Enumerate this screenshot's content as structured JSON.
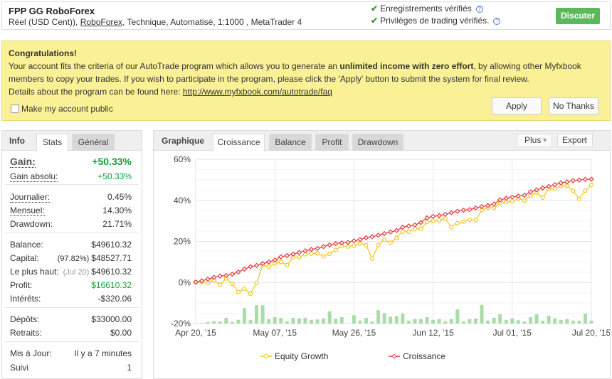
{
  "header": {
    "title": "FPP GG RoboForex",
    "subtitle_pre": "Réel (USD Cent)), ",
    "broker_link": "RoboForex",
    "subtitle_post": ", Technique, Automatisé, 1:1000 , MetaTrader 4",
    "verified": [
      "Enregistrements vérifiés",
      "Privilèges de trading vérifiés."
    ],
    "discuss_button": "Discuter"
  },
  "autotrade": {
    "title": "Congratulations!",
    "text1": "Your account fits the criteria of our AutoTrade program which allows you to generate an ",
    "text_bold": "unlimited income with zero effort",
    "text2": ", by allowing other Myfxbook members to copy your trades. If you wish to participate in the program, please click the 'Apply' button to submit the system for final review.",
    "details": "Details about the program can be found here: ",
    "link": "http://www.myfxbook.com/autotrade/faq",
    "checkbox_label": "Make my account public",
    "apply": "Apply",
    "no_thanks": "No Thanks"
  },
  "info": {
    "label": "Info",
    "tabs": [
      "Stats",
      "Général"
    ],
    "rows": [
      {
        "k": "Gain:",
        "v": "+50.33%"
      },
      {
        "k": "Gain absolu:",
        "v": "+50.33%"
      },
      {
        "k": "Journalier:",
        "v": "0.45%"
      },
      {
        "k": "Mensuel:",
        "v": "14.30%"
      },
      {
        "k": "Drawdown:",
        "v": "21.71%"
      },
      {
        "k": "Balance:",
        "v": "$49610.32"
      },
      {
        "k": "Capital:",
        "note": "(97.82%)",
        "v": "$48527.71"
      },
      {
        "k": "Le plus haut:",
        "note": "(Jul 20)",
        "v": "$49610.32"
      },
      {
        "k": "Profit:",
        "v": "$16610.32"
      },
      {
        "k": "Intérêts:",
        "v": "-$320.06"
      },
      {
        "k": "Dépôts:",
        "v": "$33000.00"
      },
      {
        "k": "Retraits:",
        "v": "$0.00"
      },
      {
        "k": "Mis à Jour:",
        "v": "Il y a 7 minutes"
      },
      {
        "k": "Suivi",
        "v": "1"
      }
    ]
  },
  "graph": {
    "label": "Graphique",
    "tabs": [
      "Croissance",
      "Balance",
      "Profit",
      "Drawdown"
    ],
    "more": "Plus",
    "export": "Export"
  },
  "chart_data": {
    "type": "line",
    "ylim": [
      -20,
      60
    ],
    "yticks": [
      "60%",
      "40%",
      "20%",
      "0%",
      "-20%"
    ],
    "ytick_values": [
      60,
      40,
      20,
      0,
      -20
    ],
    "xtick_labels": [
      "Apr 20, '15",
      "May 07, '15",
      "May 26, '15",
      "Jun 12, '15",
      "Jul 01, '15",
      "Jul 20, '15"
    ],
    "xtick_index": [
      0,
      13,
      26,
      39,
      52,
      65
    ],
    "colors": {
      "equity": "#f5c518",
      "growth": "#e8383d",
      "bars": "#a8dca8"
    },
    "series": [
      {
        "name": "Equity Growth",
        "values": [
          0.2,
          0.2,
          -0.2,
          1.0,
          -1.1,
          2.0,
          -0.6,
          -4.7,
          -3.0,
          -5.5,
          -0.2,
          8.3,
          7.7,
          9.2,
          10.0,
          8.5,
          12.3,
          12.3,
          13.7,
          14.0,
          14.2,
          12.8,
          13.9,
          15.9,
          17.8,
          17.5,
          17.9,
          18.9,
          18.2,
          11.6,
          18.2,
          20.8,
          19.4,
          21.7,
          24.8,
          24.7,
          26.2,
          26.2,
          29.4,
          29.9,
          30.3,
          31.1,
          26.9,
          28.9,
          29.6,
          30.5,
          30.3,
          35.2,
          36.4,
          36.3,
          38.6,
          39.2,
          39.5,
          40.9,
          39.9,
          42.2,
          43.8,
          41.3,
          45.5,
          45.7,
          47.0,
          47.1,
          44.7,
          40.7,
          44.7,
          47.5
        ]
      },
      {
        "name": "Croissance",
        "values": [
          0.2,
          0.8,
          1.6,
          2.5,
          3.1,
          3.4,
          4.0,
          5.1,
          6.5,
          7.7,
          8.3,
          9.2,
          10.0,
          10.9,
          12.5,
          13.1,
          13.8,
          14.6,
          15.4,
          16.1,
          16.6,
          17.5,
          18.3,
          18.9,
          19.3,
          19.5,
          20.3,
          20.9,
          21.8,
          22.3,
          23.0,
          23.8,
          24.6,
          25.3,
          26.9,
          27.5,
          28.0,
          29.2,
          31.5,
          32.2,
          32.6,
          33.2,
          34.0,
          34.7,
          35.2,
          35.5,
          36.3,
          37.0,
          37.5,
          38.2,
          40.2,
          41.0,
          41.6,
          42.1,
          42.5,
          44.1,
          45.1,
          46.0,
          46.8,
          47.6,
          48.5,
          49.0,
          49.6,
          49.9,
          50.2,
          50.33
        ]
      },
      {
        "name": "Daily profit bars",
        "values": [
          0.2,
          0.3,
          0.8,
          1.2,
          1,
          2.8,
          0.7,
          1.8,
          7.5,
          1.8,
          8.9,
          8.9,
          2.2,
          3.1,
          2.8,
          1,
          2.8,
          2.5,
          2.8,
          1.8,
          2,
          2.5,
          6,
          2.3,
          3.1,
          0.2,
          4,
          1.4,
          2.8,
          1,
          6.5,
          5,
          3.3,
          3.6,
          4.8,
          1.4,
          2.2,
          2.2,
          3.1,
          1.8,
          2.2,
          1,
          2.2,
          6.9,
          1,
          2.2,
          2.5,
          9.1,
          1.4,
          2.8,
          4.5,
          1.8,
          2.5,
          1.6,
          1,
          3.1,
          4.5,
          1.4,
          3.8,
          2.5,
          1.8,
          2.2,
          1.4,
          1.4,
          4.8,
          1.4
        ]
      }
    ]
  }
}
